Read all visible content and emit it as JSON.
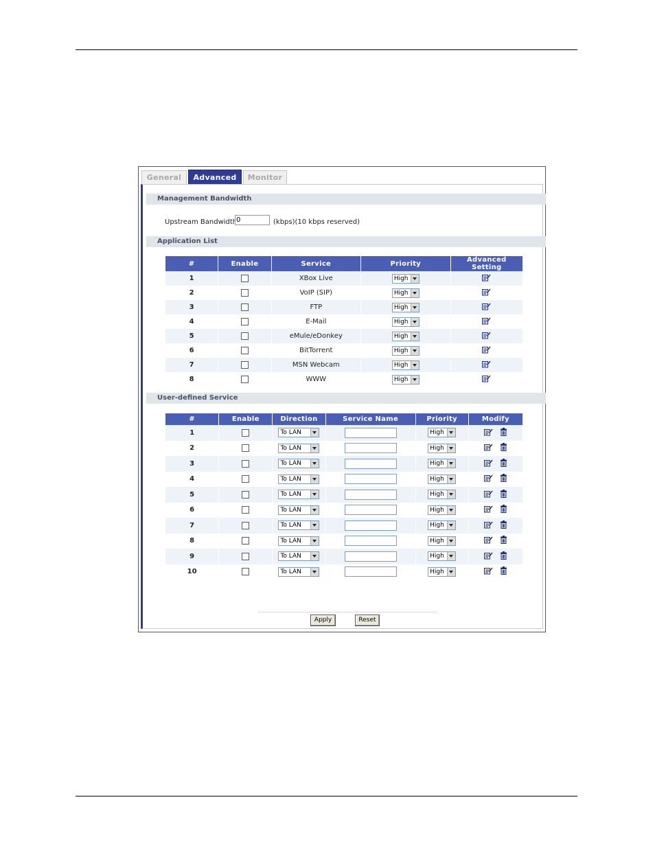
{
  "tabs": [
    {
      "label": "General",
      "active": false
    },
    {
      "label": "Advanced",
      "active": true
    },
    {
      "label": "Monitor",
      "active": false
    }
  ],
  "management": {
    "title": "Management Bandwidth",
    "upstream_label": "Upstream Bandwidth",
    "upstream_value": "0",
    "upstream_unit": "(kbps)(10 kbps reserved)"
  },
  "application_list": {
    "title": "Application List",
    "headers": [
      "#",
      "Enable",
      "Service",
      "Priority",
      "Advanced Setting"
    ],
    "rows": [
      {
        "num": "1",
        "service": "XBox Live",
        "priority": "High"
      },
      {
        "num": "2",
        "service": "VoIP (SIP)",
        "priority": "High"
      },
      {
        "num": "3",
        "service": "FTP",
        "priority": "High"
      },
      {
        "num": "4",
        "service": "E-Mail",
        "priority": "High"
      },
      {
        "num": "5",
        "service": "eMule/eDonkey",
        "priority": "High"
      },
      {
        "num": "6",
        "service": "BitTorrent",
        "priority": "High"
      },
      {
        "num": "7",
        "service": "MSN Webcam",
        "priority": "High"
      },
      {
        "num": "8",
        "service": "WWW",
        "priority": "High"
      }
    ]
  },
  "user_defined": {
    "title": "User-defined Service",
    "headers": [
      "#",
      "Enable",
      "Direction",
      "Service Name",
      "Priority",
      "Modify"
    ],
    "rows": [
      {
        "num": "1",
        "direction": "To LAN",
        "service_name": "",
        "priority": "High"
      },
      {
        "num": "2",
        "direction": "To LAN",
        "service_name": "",
        "priority": "High"
      },
      {
        "num": "3",
        "direction": "To LAN",
        "service_name": "",
        "priority": "High"
      },
      {
        "num": "4",
        "direction": "To LAN",
        "service_name": "",
        "priority": "High"
      },
      {
        "num": "5",
        "direction": "To LAN",
        "service_name": "",
        "priority": "High"
      },
      {
        "num": "6",
        "direction": "To LAN",
        "service_name": "",
        "priority": "High"
      },
      {
        "num": "7",
        "direction": "To LAN",
        "service_name": "",
        "priority": "High"
      },
      {
        "num": "8",
        "direction": "To LAN",
        "service_name": "",
        "priority": "High"
      },
      {
        "num": "9",
        "direction": "To LAN",
        "service_name": "",
        "priority": "High"
      },
      {
        "num": "10",
        "direction": "To LAN",
        "service_name": "",
        "priority": "High"
      }
    ]
  },
  "buttons": {
    "apply": "Apply",
    "reset": "Reset"
  },
  "colors": {
    "accent": "#2f3c95",
    "header": "#4a5fb4",
    "section": "#dfe5e9"
  }
}
